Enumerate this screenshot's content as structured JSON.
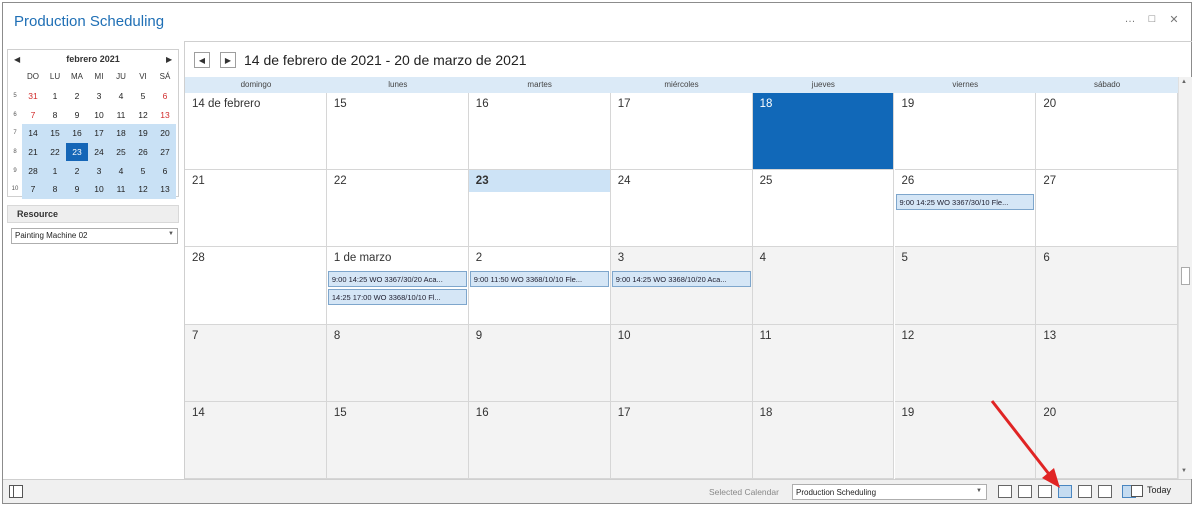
{
  "window": {
    "title": "Production Scheduling",
    "minimize": "…",
    "maximize": "□",
    "close": "✕"
  },
  "mini_calendar": {
    "month_label": "febrero 2021",
    "prev": "◀",
    "next": "▶",
    "weekdays": [
      "DO",
      "LU",
      "MA",
      "MI",
      "JU",
      "VI",
      "SÁ"
    ],
    "weeks": [
      {
        "week": "5",
        "days": [
          "31",
          "1",
          "2",
          "3",
          "4",
          "5",
          "6"
        ]
      },
      {
        "week": "6",
        "days": [
          "7",
          "8",
          "9",
          "10",
          "11",
          "12",
          "13"
        ]
      },
      {
        "week": "7",
        "days": [
          "14",
          "15",
          "16",
          "17",
          "18",
          "19",
          "20"
        ]
      },
      {
        "week": "8",
        "days": [
          "21",
          "22",
          "23",
          "24",
          "25",
          "26",
          "27"
        ]
      },
      {
        "week": "9",
        "days": [
          "28",
          "1",
          "2",
          "3",
          "4",
          "5",
          "6"
        ]
      },
      {
        "week": "10",
        "days": [
          "7",
          "8",
          "9",
          "10",
          "11",
          "12",
          "13"
        ]
      }
    ],
    "today": "23",
    "weekend_color": "#d12b2b",
    "selection_color": "#c9e1f5"
  },
  "resource": {
    "header": "Resource",
    "value": "Painting Machine 02"
  },
  "calendar": {
    "range_title": "14 de febrero de 2021 - 20 de marzo de 2021",
    "prev_icon": "◀",
    "next_icon": "▶",
    "weekdays": [
      "domingo",
      "lunes",
      "martes",
      "miércoles",
      "jueves",
      "viernes",
      "sábado"
    ],
    "weeks": [
      [
        "14 de febrero",
        "15",
        "16",
        "17",
        "18",
        "19",
        "20"
      ],
      [
        "21",
        "22",
        "23",
        "24",
        "25",
        "26",
        "27"
      ],
      [
        "28",
        "1 de marzo",
        "2",
        "3",
        "4",
        "5",
        "6"
      ],
      [
        "7",
        "8",
        "9",
        "10",
        "11",
        "12",
        "13"
      ],
      [
        "14",
        "15",
        "16",
        "17",
        "18",
        "19",
        "20"
      ]
    ],
    "appointments": [
      {
        "text": "9:00  14:25  WO 3367/30/10 Fle..."
      },
      {
        "text": "9:00  14:25  WO 3367/30/20 Aca..."
      },
      {
        "text": "14:25  17:00  WO 3368/10/10 Fl..."
      },
      {
        "text": "9:00  11:50  WO 3368/10/10 Fle..."
      },
      {
        "text": "9:00  14:25  WO 3368/10/20 Aca..."
      }
    ],
    "highlight_color": "#1168b8"
  },
  "statusbar": {
    "selected_calendar_label": "Selected Calendar",
    "selected_calendar_value": "Production Scheduling",
    "today_label": "Today"
  }
}
